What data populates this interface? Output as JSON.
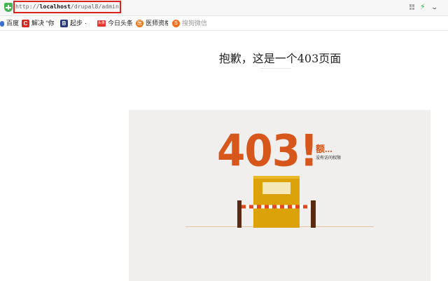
{
  "browser": {
    "url_prefix": "http://",
    "url_host": "localhost",
    "url_path": "/drupal8/admin",
    "bookmarks": [
      {
        "label": "百度",
        "icon": "baidu-paw-icon"
      },
      {
        "label": "解决 “你",
        "icon": "c-letter-icon",
        "icon_text": "C"
      },
      {
        "label": "起步",
        "icon": "b-letter-icon",
        "icon_text": "B"
      },
      {
        "label": "今日头条",
        "icon": "toutiao-icon",
        "icon_text": "头条"
      },
      {
        "label": "医师资格",
        "icon": "doctor-icon",
        "icon_text": "医"
      },
      {
        "label": "搜狗微信",
        "icon": "sogou-icon",
        "icon_text": "S"
      }
    ],
    "bookmark_separator": "·"
  },
  "page": {
    "heading": "抱歉，这是一个403页面",
    "error_code": "403!",
    "error_exclaim": "额...",
    "error_message": "没有访问权限"
  },
  "colors": {
    "accent_orange": "#d6561b",
    "booth_yellow": "#dba20a",
    "booth_inner": "#f5e8b8",
    "post_brown": "#5b2a12",
    "panel_bg": "#f0efed"
  }
}
